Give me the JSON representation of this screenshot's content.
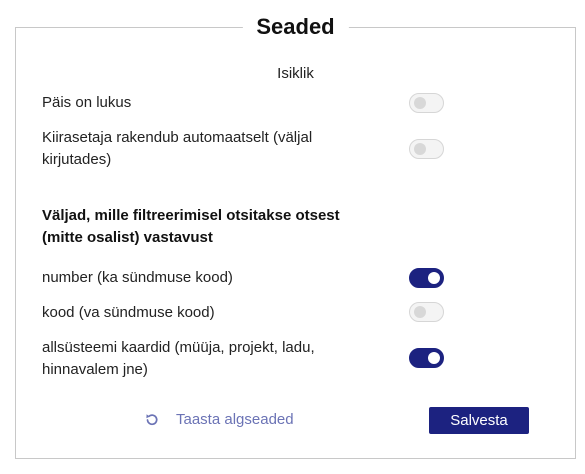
{
  "panel": {
    "title": "Seaded",
    "section_label": "Isiklik"
  },
  "personal_settings": [
    {
      "label": "Päis on lukus",
      "enabled": false
    },
    {
      "label": "Kiirasetaja rakendub automaatselt (väljal kirjutades)",
      "enabled": false
    }
  ],
  "exact_match": {
    "heading": "Väljad, mille filtreerimisel otsitakse otsest (mitte osalist) vastavust",
    "items": [
      {
        "label": "number (ka sündmuse kood)",
        "enabled": true
      },
      {
        "label": "kood (va sündmuse kood)",
        "enabled": false
      },
      {
        "label": "allsüsteemi kaardid (müüja, projekt, ladu, hinnavalem jne)",
        "enabled": true
      }
    ]
  },
  "actions": {
    "reset_label": "Taasta algseaded",
    "reset_icon": "undo-icon",
    "save_label": "Salvesta"
  },
  "colors": {
    "accent": "#1c2280",
    "link": "#6b73b5",
    "toggle_off": "#f4f4f4"
  }
}
